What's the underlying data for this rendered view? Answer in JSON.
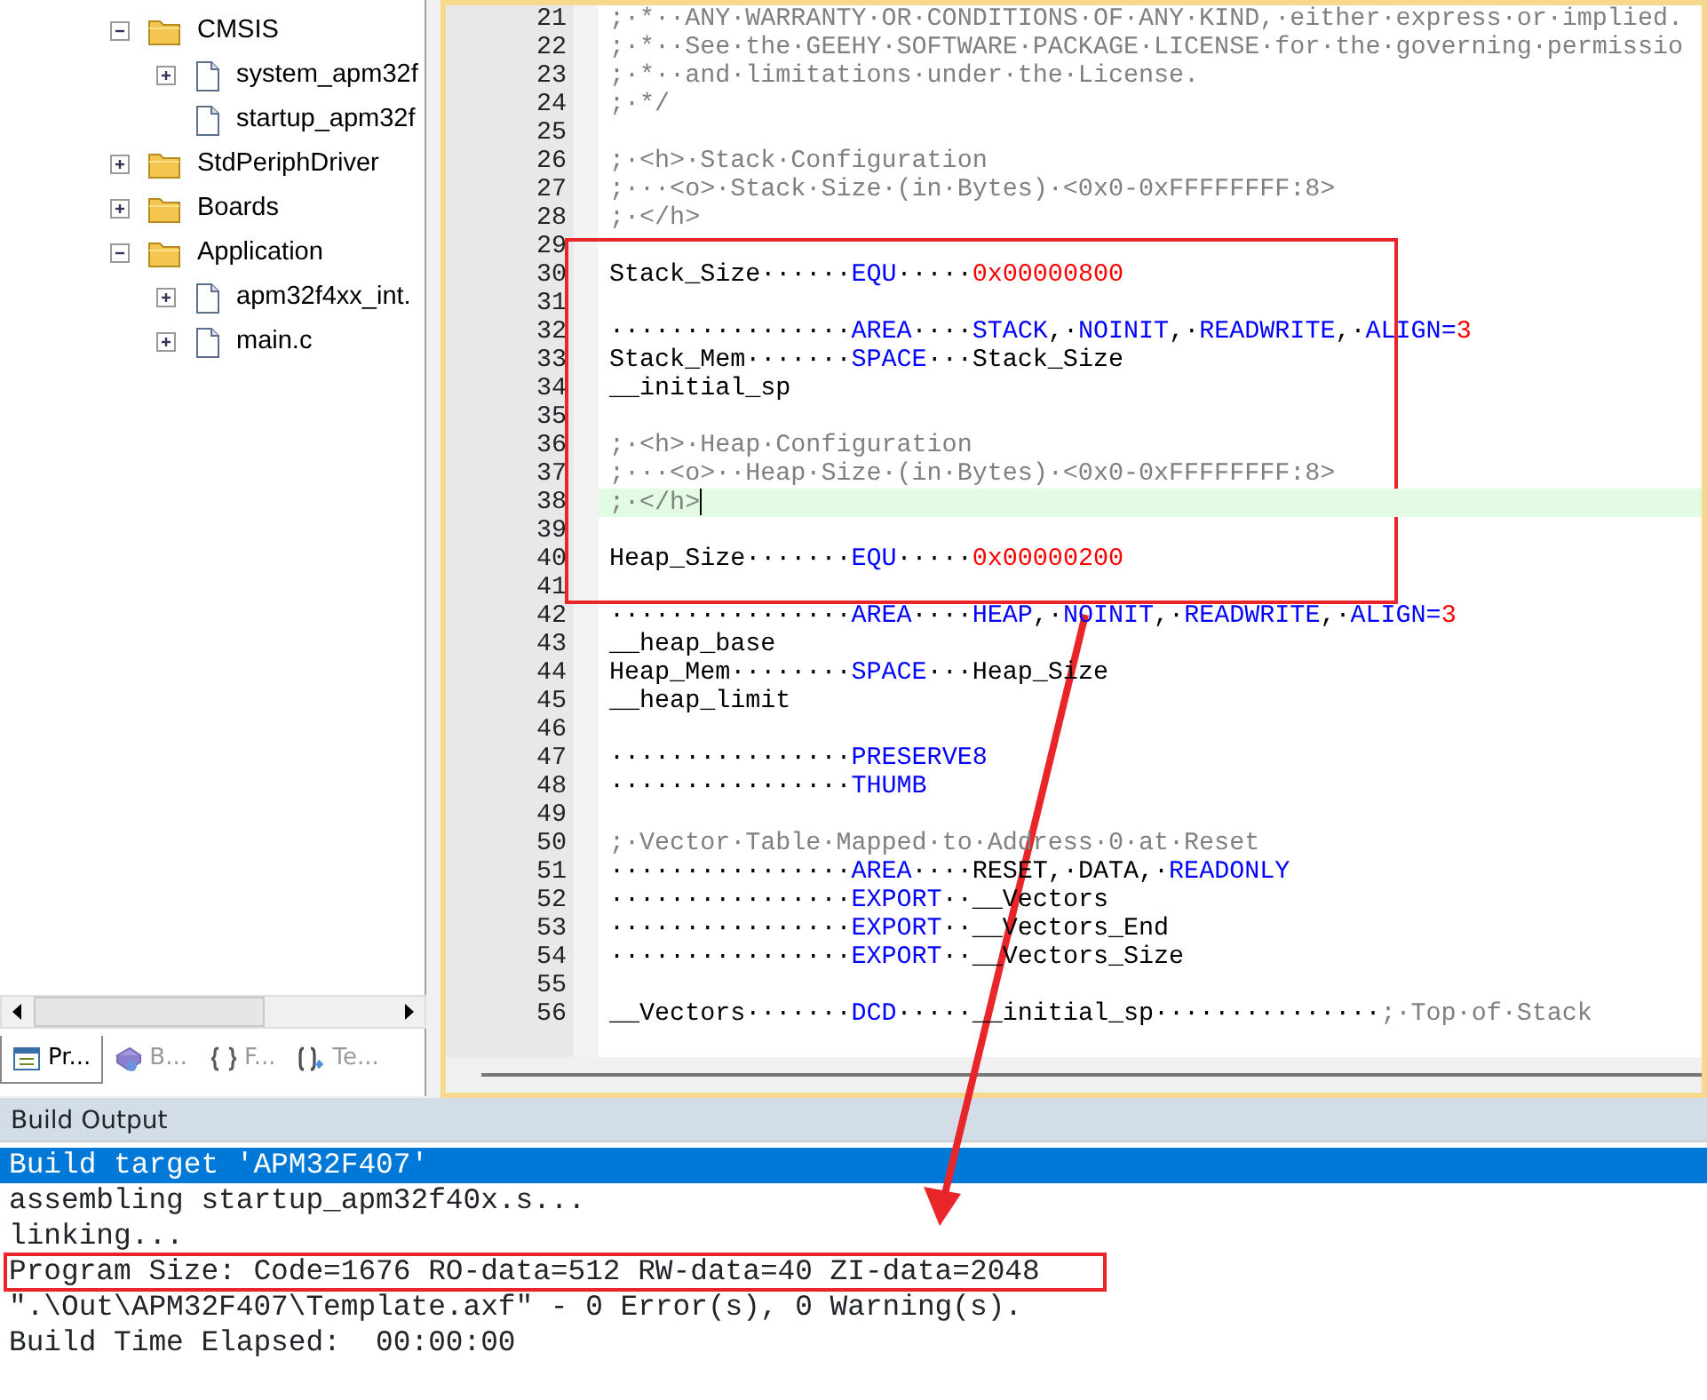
{
  "project_tree": {
    "items": [
      {
        "label": "CMSIS",
        "kind": "folder",
        "expanded": true,
        "children": [
          {
            "label": "system_apm32f",
            "kind": "file",
            "expanded": false
          },
          {
            "label": "startup_apm32f",
            "kind": "leaf_file"
          }
        ]
      },
      {
        "label": "StdPeriphDriver",
        "kind": "folder",
        "expanded": false
      },
      {
        "label": "Boards",
        "kind": "folder",
        "expanded": false
      },
      {
        "label": "Application",
        "kind": "folder",
        "expanded": true,
        "children": [
          {
            "label": "apm32f4xx_int.",
            "kind": "file",
            "expanded": false
          },
          {
            "label": "main.c",
            "kind": "file",
            "expanded": false
          }
        ]
      }
    ]
  },
  "panel_tabs": [
    {
      "label": "Pr...",
      "kind": "project",
      "selected": true
    },
    {
      "label": "B...",
      "kind": "books",
      "selected": false
    },
    {
      "label": "F...",
      "kind": "functions",
      "selected": false
    },
    {
      "label": "Te...",
      "kind": "templates",
      "selected": false
    }
  ],
  "editor": {
    "lines": [
      {
        "number": "21",
        "current": false,
        "tokens": [
          {
            "kind": "comment",
            "text": ";·*··ANY·WARRANTY·OR·CONDITIONS·OF·ANY·KIND,·either·express·or·implied."
          }
        ]
      },
      {
        "number": "22",
        "current": false,
        "tokens": [
          {
            "kind": "comment",
            "text": ";·*··See·the·GEEHY·SOFTWARE·PACKAGE·LICENSE·for·the·governing·permissio"
          }
        ]
      },
      {
        "number": "23",
        "current": false,
        "tokens": [
          {
            "kind": "comment",
            "text": ";·*··and·limitations·under·the·License."
          }
        ]
      },
      {
        "number": "24",
        "current": false,
        "tokens": [
          {
            "kind": "comment",
            "text": ";·*/"
          }
        ]
      },
      {
        "number": "25",
        "current": false
      },
      {
        "number": "26",
        "current": false,
        "tokens": [
          {
            "kind": "comment",
            "text": ";·<h>·Stack·Configuration"
          }
        ]
      },
      {
        "number": "27",
        "current": false,
        "tokens": [
          {
            "kind": "comment",
            "text": ";···<o>·Stack·Size·(in·Bytes)·<0x0-0xFFFFFFFF:8>"
          }
        ]
      },
      {
        "number": "28",
        "current": false,
        "tokens": [
          {
            "kind": "comment",
            "text": ";·</h>"
          }
        ]
      },
      {
        "number": "29",
        "current": false
      },
      {
        "number": "30",
        "current": false,
        "tokens": [
          {
            "kind": "plain",
            "text": "Stack_Size······"
          },
          {
            "kind": "keyword",
            "text": "EQU"
          },
          {
            "kind": "plain",
            "text": "·····"
          },
          {
            "kind": "number",
            "text": "0x00000800"
          }
        ]
      },
      {
        "number": "31",
        "current": false
      },
      {
        "number": "32",
        "current": false,
        "tokens": [
          {
            "kind": "plain",
            "text": "················"
          },
          {
            "kind": "keyword",
            "text": "AREA"
          },
          {
            "kind": "plain",
            "text": "····"
          },
          {
            "kind": "keyword",
            "text": "STACK"
          },
          {
            "kind": "plain",
            "text": ",·"
          },
          {
            "kind": "keyword",
            "text": "NOINIT"
          },
          {
            "kind": "plain",
            "text": ",·"
          },
          {
            "kind": "keyword",
            "text": "READWRITE"
          },
          {
            "kind": "plain",
            "text": ",·"
          },
          {
            "kind": "keyword",
            "text": "ALIGN="
          },
          {
            "kind": "number",
            "text": "3"
          }
        ]
      },
      {
        "number": "33",
        "current": false,
        "tokens": [
          {
            "kind": "plain",
            "text": "Stack_Mem·······"
          },
          {
            "kind": "keyword",
            "text": "SPACE"
          },
          {
            "kind": "plain",
            "text": "···Stack_Size"
          }
        ]
      },
      {
        "number": "34",
        "current": false,
        "tokens": [
          {
            "kind": "plain",
            "text": "__initial_sp"
          }
        ]
      },
      {
        "number": "35",
        "current": false
      },
      {
        "number": "36",
        "current": false,
        "tokens": [
          {
            "kind": "comment",
            "text": ";·<h>·Heap·Configuration"
          }
        ]
      },
      {
        "number": "37",
        "current": false,
        "tokens": [
          {
            "kind": "comment",
            "text": ";···<o>··Heap·Size·(in·Bytes)·<0x0-0xFFFFFFFF:8>"
          }
        ]
      },
      {
        "number": "38",
        "current": true,
        "tokens": [
          {
            "kind": "comment",
            "text": ";·</h>"
          }
        ]
      },
      {
        "number": "39",
        "current": false
      },
      {
        "number": "40",
        "current": false,
        "tokens": [
          {
            "kind": "plain",
            "text": "Heap_Size·······"
          },
          {
            "kind": "keyword",
            "text": "EQU"
          },
          {
            "kind": "plain",
            "text": "·····"
          },
          {
            "kind": "number",
            "text": "0x00000200"
          }
        ]
      },
      {
        "number": "41",
        "current": false
      },
      {
        "number": "42",
        "current": false,
        "tokens": [
          {
            "kind": "plain",
            "text": "················"
          },
          {
            "kind": "keyword",
            "text": "AREA"
          },
          {
            "kind": "plain",
            "text": "····"
          },
          {
            "kind": "keyword",
            "text": "HEAP"
          },
          {
            "kind": "plain",
            "text": ",·"
          },
          {
            "kind": "keyword",
            "text": "NOINIT"
          },
          {
            "kind": "plain",
            "text": ",·"
          },
          {
            "kind": "keyword",
            "text": "READWRITE"
          },
          {
            "kind": "plain",
            "text": ",·"
          },
          {
            "kind": "keyword",
            "text": "ALIGN="
          },
          {
            "kind": "number",
            "text": "3"
          }
        ]
      },
      {
        "number": "43",
        "current": false,
        "tokens": [
          {
            "kind": "plain",
            "text": "__heap_base"
          }
        ]
      },
      {
        "number": "44",
        "current": false,
        "tokens": [
          {
            "kind": "plain",
            "text": "Heap_Mem········"
          },
          {
            "kind": "keyword",
            "text": "SPACE"
          },
          {
            "kind": "plain",
            "text": "···Heap_Size"
          }
        ]
      },
      {
        "number": "45",
        "current": false,
        "tokens": [
          {
            "kind": "plain",
            "text": "__heap_limit"
          }
        ]
      },
      {
        "number": "46",
        "current": false
      },
      {
        "number": "47",
        "current": false,
        "tokens": [
          {
            "kind": "plain",
            "text": "················"
          },
          {
            "kind": "keyword",
            "text": "PRESERVE8"
          }
        ]
      },
      {
        "number": "48",
        "current": false,
        "tokens": [
          {
            "kind": "plain",
            "text": "················"
          },
          {
            "kind": "keyword",
            "text": "THUMB"
          }
        ]
      },
      {
        "number": "49",
        "current": false
      },
      {
        "number": "50",
        "current": false,
        "tokens": [
          {
            "kind": "comment",
            "text": ";·Vector·Table·Mapped·to·Address·0·at·Reset"
          }
        ]
      },
      {
        "number": "51",
        "current": false,
        "tokens": [
          {
            "kind": "plain",
            "text": "················"
          },
          {
            "kind": "keyword",
            "text": "AREA"
          },
          {
            "kind": "plain",
            "text": "····RESET,·DATA,·"
          },
          {
            "kind": "keyword",
            "text": "READONLY"
          }
        ]
      },
      {
        "number": "52",
        "current": false,
        "tokens": [
          {
            "kind": "plain",
            "text": "················"
          },
          {
            "kind": "keyword",
            "text": "EXPORT"
          },
          {
            "kind": "plain",
            "text": "··__Vectors"
          }
        ]
      },
      {
        "number": "53",
        "current": false,
        "tokens": [
          {
            "kind": "plain",
            "text": "················"
          },
          {
            "kind": "keyword",
            "text": "EXPORT"
          },
          {
            "kind": "plain",
            "text": "··__Vectors_End"
          }
        ]
      },
      {
        "number": "54",
        "current": false,
        "tokens": [
          {
            "kind": "plain",
            "text": "················"
          },
          {
            "kind": "keyword",
            "text": "EXPORT"
          },
          {
            "kind": "plain",
            "text": "··__Vectors_Size"
          }
        ]
      },
      {
        "number": "55",
        "current": false
      },
      {
        "number": "56",
        "current": false,
        "tokens": [
          {
            "kind": "plain",
            "text": "__Vectors·······"
          },
          {
            "kind": "keyword",
            "text": "DCD"
          },
          {
            "kind": "plain",
            "text": "·····__initial_sp···············"
          },
          {
            "kind": "comment",
            "text": ";·Top·of·Stack"
          }
        ]
      }
    ]
  },
  "build_output": {
    "title": "Build Output",
    "lines": [
      {
        "text": "Build target 'APM32F407'",
        "selected": true
      },
      {
        "text": "assembling startup_apm32f40x.s...",
        "selected": false
      },
      {
        "text": "linking...",
        "selected": false
      },
      {
        "text": "Program Size: Code=1676 RO-data=512 RW-data=40 ZI-data=2048",
        "selected": false
      },
      {
        "text": "\".\\Out\\APM32F407\\Template.axf\" - 0 Error(s), 0 Warning(s).",
        "selected": false
      },
      {
        "text": "Build Time Elapsed:  00:00:00",
        "selected": false
      }
    ]
  }
}
